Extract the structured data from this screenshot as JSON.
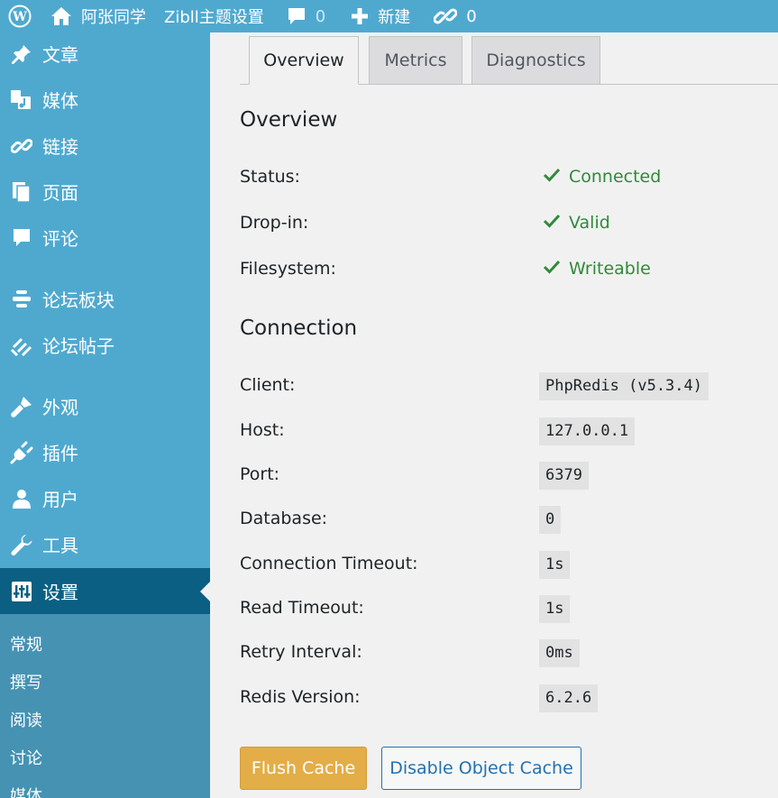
{
  "adminbar": {
    "site_name": "阿张同学",
    "theme_settings": "Zibll主题设置",
    "comments_count": "0",
    "new_label": "新建",
    "links_count": "0"
  },
  "sidebar": {
    "items": [
      {
        "label": "文章",
        "icon": "pushpin-icon"
      },
      {
        "label": "媒体",
        "icon": "media-icon"
      },
      {
        "label": "链接",
        "icon": "link-icon"
      },
      {
        "label": "页面",
        "icon": "pages-icon"
      },
      {
        "label": "评论",
        "icon": "comment-icon"
      },
      {
        "label": "论坛板块",
        "icon": "forum-boards-icon"
      },
      {
        "label": "论坛帖子",
        "icon": "forum-posts-icon"
      },
      {
        "label": "外观",
        "icon": "appearance-icon"
      },
      {
        "label": "插件",
        "icon": "plugin-icon"
      },
      {
        "label": "用户",
        "icon": "users-icon"
      },
      {
        "label": "工具",
        "icon": "tools-icon"
      },
      {
        "label": "设置",
        "icon": "settings-icon"
      }
    ],
    "submenu": [
      "常规",
      "撰写",
      "阅读",
      "讨论",
      "媒体"
    ]
  },
  "tabs": [
    "Overview",
    "Metrics",
    "Diagnostics"
  ],
  "overview": {
    "title": "Overview",
    "rows": [
      {
        "label": "Status:",
        "value": "Connected"
      },
      {
        "label": "Drop-in:",
        "value": "Valid"
      },
      {
        "label": "Filesystem:",
        "value": "Writeable"
      }
    ]
  },
  "connection": {
    "title": "Connection",
    "rows": [
      {
        "label": "Client:",
        "value": "PhpRedis (v5.3.4)"
      },
      {
        "label": "Host:",
        "value": "127.0.0.1"
      },
      {
        "label": "Port:",
        "value": "6379"
      },
      {
        "label": "Database:",
        "value": "0"
      },
      {
        "label": "Connection Timeout:",
        "value": "1s"
      },
      {
        "label": "Read Timeout:",
        "value": "1s"
      },
      {
        "label": "Retry Interval:",
        "value": "0ms"
      },
      {
        "label": "Redis Version:",
        "value": "6.2.6"
      }
    ]
  },
  "buttons": {
    "flush": "Flush Cache",
    "disable": "Disable Object Cache"
  },
  "colors": {
    "sidebar": "#4fa9cf",
    "sidebar_current": "#0a5f83",
    "status_ok": "#2f8a3a",
    "primary_button": "#e3ad47",
    "link_blue": "#2271b1"
  }
}
